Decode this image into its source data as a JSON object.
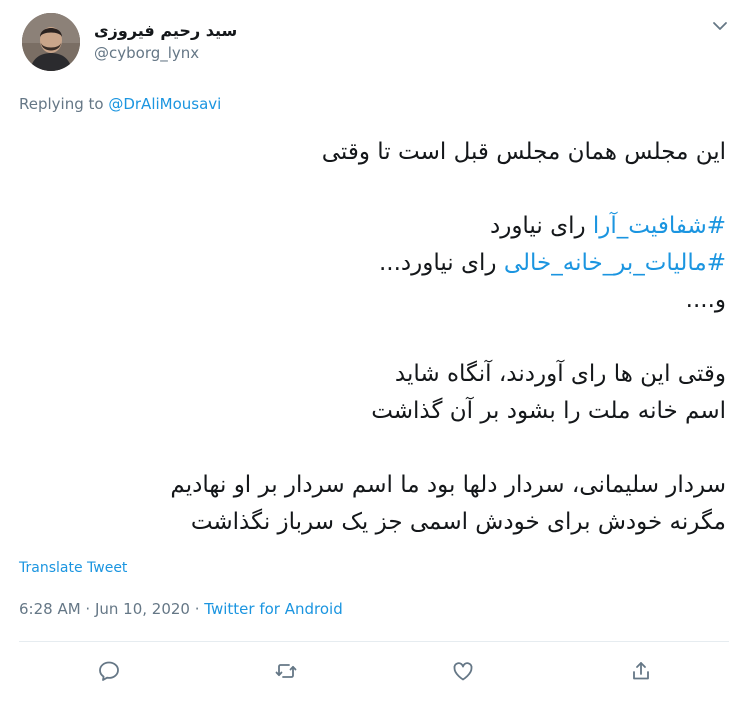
{
  "author": {
    "display_name": "سید رحیم فیروزی",
    "handle": "@cyborg_lynx"
  },
  "reply": {
    "prefix": "Replying to ",
    "to": "@DrAliMousavi"
  },
  "tweet": {
    "line1": "این مجلس همان مجلس قبل است تا وقتی",
    "line2_hashtag": "#شفافیت_آرا",
    "line2_text": " رای نیاورد",
    "line3_hashtag": "#مالیات_بر_خانه_خالی",
    "line3_text": " رای نیاورد...",
    "line4": "و....",
    "line5": "وقتی این ها رای آوردند، آنگاه شاید",
    "line6": "اسم خانه ملت را بشود بر آن گذاشت",
    "line7": "سردار سلیمانی، سردار دلها بود ما اسم سردار بر او نهادیم",
    "line8": "مگرنه خودش برای خودش اسمی جز یک سرباز نگذاشت"
  },
  "translate_label": "Translate Tweet",
  "meta": {
    "time": "6:28 AM",
    "sep1": " · ",
    "date": "Jun 10, 2020",
    "sep2": " · ",
    "source": "Twitter for Android"
  },
  "icons": {
    "caret": "chevron-down-icon",
    "reply": "reply-icon",
    "retweet": "retweet-icon",
    "like": "heart-icon",
    "share": "share-icon"
  },
  "colors": {
    "link": "#1b95e0",
    "secondary": "#657786",
    "text": "#14171a",
    "divider": "#e6ecf0"
  }
}
